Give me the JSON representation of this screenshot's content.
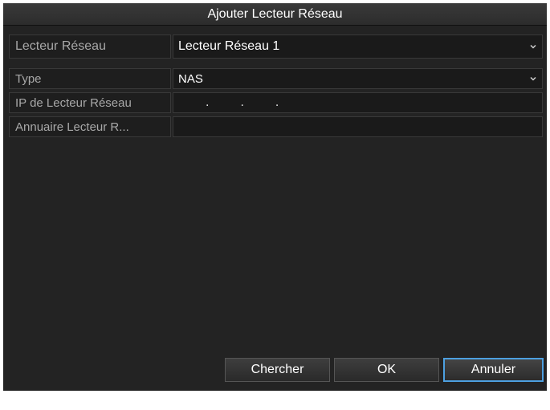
{
  "dialog": {
    "title": "Ajouter Lecteur Réseau"
  },
  "form": {
    "drive": {
      "label": "Lecteur Réseau",
      "value": "Lecteur Réseau 1"
    },
    "type": {
      "label": "Type",
      "value": "NAS"
    },
    "ip": {
      "label": "IP de Lecteur Réseau",
      "segments": [
        ".",
        ".",
        "."
      ]
    },
    "directory": {
      "label": "Annuaire Lecteur R...",
      "value": ""
    }
  },
  "buttons": {
    "search": "Chercher",
    "ok": "OK",
    "cancel": "Annuler"
  },
  "colors": {
    "background": "#232323",
    "focus_border": "#4da0e0"
  }
}
